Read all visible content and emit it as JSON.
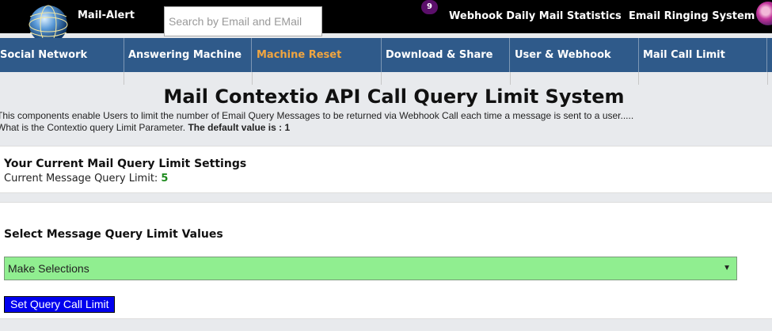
{
  "topbar": {
    "brand": "Mail-Alert",
    "search_placeholder": "Search by Email and EMail",
    "badge_count": "9",
    "links": [
      "Webhook Daily Mail Statistics",
      "Email Ringing System"
    ]
  },
  "navbar": {
    "items": [
      {
        "label": "Social Network"
      },
      {
        "label": "Answering Machine"
      },
      {
        "label": "Machine Reset",
        "active": true
      },
      {
        "label": "Download & Share"
      },
      {
        "label": "User & Webhook"
      },
      {
        "label": "Mail Call Limit"
      }
    ],
    "active_color": "#f0a540"
  },
  "header": {
    "title": "Mail Contextio API Call Query Limit System",
    "desc_line1": "This components enable Users to limit the number of Email Query Messages to be returned via Webhook Call each time a message is sent to a user.....",
    "desc_line2": "What is the Contextio query Limit Parameter.",
    "desc_default": "The default value is : 1"
  },
  "settings": {
    "heading": "Your Current Mail Query Limit Settings",
    "label": "Current Message Query Limit:",
    "value": "5"
  },
  "selection": {
    "heading": "Select Message Query Limit Values",
    "selected": "Make Selections",
    "button": "Set Query Call Limit"
  },
  "colors": {
    "topbar": "#000000",
    "navbar": "#2f5a8a",
    "select_bg": "#90ee90",
    "button_bg": "#0000ee",
    "value_green": "#1d8a1d"
  },
  "icons": [
    "globe-logo-icon",
    "chevron-down-icon",
    "user-avatar"
  ]
}
